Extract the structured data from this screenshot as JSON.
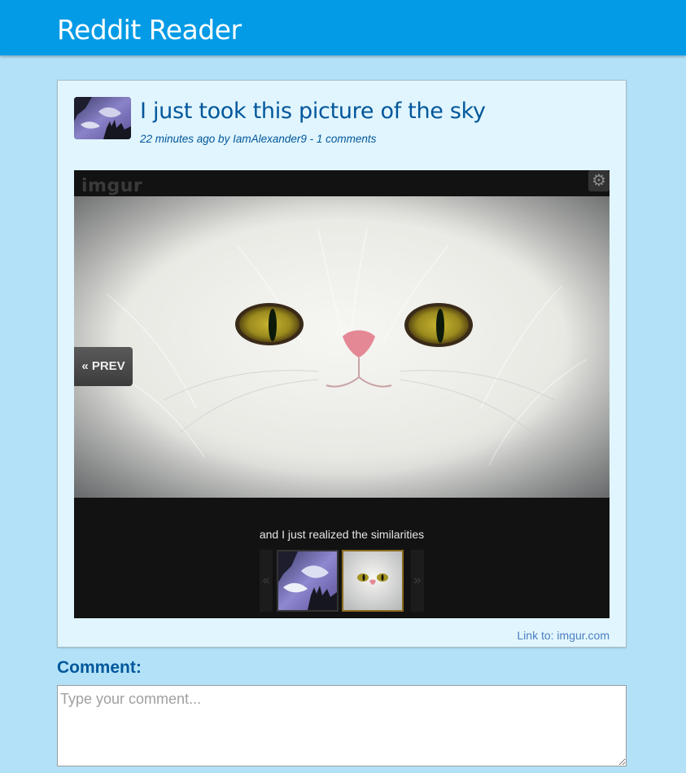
{
  "app": {
    "title": "Reddit Reader"
  },
  "post": {
    "title": "I just took this picture of the sky",
    "meta": "22 minutes ago by IamAlexander9 - 1 comments",
    "thumbnail_icon": "sky-thumbnail-image"
  },
  "embed": {
    "logo": "imgur",
    "settings_icon": "gear-icon",
    "prev_label": "« PREV",
    "caption": "and I just realized the similarities",
    "strip_left_arrow": "«",
    "strip_right_arrow": "»",
    "image_subject": "white-persian-cat",
    "thumbnails": [
      "sky-photo",
      "white-cat-photo"
    ],
    "selected_thumbnail": "white-cat-photo"
  },
  "footer_link": "Link to: imgur.com",
  "comment": {
    "label": "Comment:",
    "placeholder": "Type your comment..."
  },
  "colors": {
    "header": "#039be5",
    "page_bg": "#b3e2f8",
    "card_bg": "#e1f5fe",
    "title_blue": "#01579b",
    "link_blue": "#4a7fc1"
  }
}
